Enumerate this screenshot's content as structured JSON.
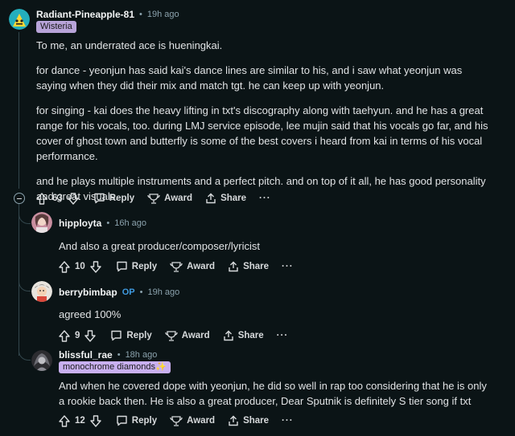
{
  "comments": [
    {
      "username": "Radiant-Pineapple-81",
      "time": "19h ago",
      "flair": "Wisteria",
      "paragraphs": [
        "To me, an underrated ace is hueningkai.",
        "for dance - yeonjun has said kai's dance lines are similar to his, and i saw what yeonjun was saying when they did their mix and match tgt. he can keep up with yeonjun.",
        "for singing - kai does the heavy lifting in txt's discography along with taehyun. and he has a great range for his vocals, too. during LMJ service episode, lee mujin said that his vocals go far, and his cover of ghost town and butterfly is some of the best covers i heard from kai in terms of his vocal performance.",
        "and he plays multiple instruments and a perfect pitch. and on top of it all, he has good personality and great visuals."
      ],
      "votes": "63"
    },
    {
      "username": "hipployta",
      "time": "16h ago",
      "paragraphs": [
        "And also a great producer/composer/lyricist"
      ],
      "votes": "10"
    },
    {
      "username": "berrybimbap",
      "op_badge": "OP",
      "time": "19h ago",
      "paragraphs": [
        "agreed 100%"
      ],
      "votes": "9"
    },
    {
      "username": "blissful_rae",
      "time": "18h ago",
      "flair": "monochrome diamonds✨",
      "paragraphs": [
        "And when he covered dope with yeonjun, he did so well in rap too considering that he is only a rookie back then. He is also a great producer, Dear Sputnik is definitely S tier song if txt"
      ],
      "votes": "12"
    }
  ],
  "actions": {
    "reply": "Reply",
    "award": "Award",
    "share": "Share",
    "more": "···"
  },
  "meta_separator": "•",
  "colors": {
    "background": "#0b1416",
    "flair_wisteria": "#b8a4d9",
    "flair_monochrome": "#c9b0f0",
    "op_badge": "#3f9ae0",
    "thread_line": "#33464c"
  },
  "icons": [
    "upvote-icon",
    "downvote-icon",
    "reply-icon",
    "award-icon",
    "share-icon",
    "more-icon",
    "collapse-icon"
  ]
}
